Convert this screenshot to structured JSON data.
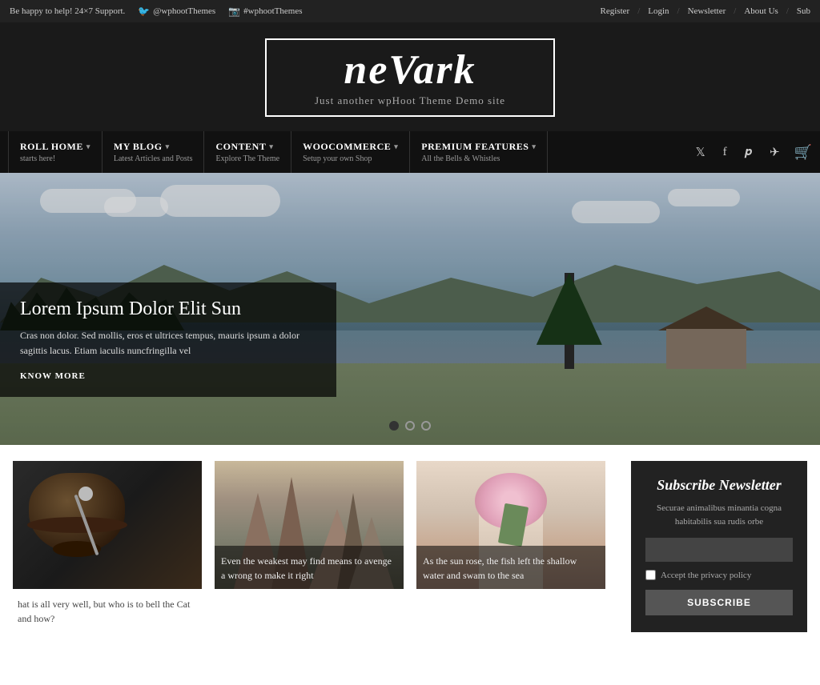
{
  "topbar": {
    "support_text": "Be happy to help! 24×7 Support.",
    "twitter_handle": "@wphootThemes",
    "instagram_handle": "#wphootThemes",
    "register": "Register",
    "login": "Login",
    "newsletter": "Newsletter",
    "about_us": "About Us",
    "subscribe": "Sub"
  },
  "site": {
    "title_ne": "ne",
    "title_vark": "Vark",
    "tagline": "Just another wpHoot Theme Demo site"
  },
  "nav": {
    "items": [
      {
        "id": "roll-home",
        "title": "ROLL HOME",
        "sub": "starts here!",
        "has_dropdown": true
      },
      {
        "id": "my-blog",
        "title": "MY BLOG",
        "sub": "Latest Articles and Posts",
        "has_dropdown": true
      },
      {
        "id": "content",
        "title": "CONTENT",
        "sub": "Explore The Theme",
        "has_dropdown": true
      },
      {
        "id": "woocommerce",
        "title": "WOOCOMMERCE",
        "sub": "Setup your own Shop",
        "has_dropdown": true
      },
      {
        "id": "premium-features",
        "title": "PREMIUM FEATURES",
        "sub": "All the Bells & Whistles",
        "has_dropdown": true
      }
    ]
  },
  "hero": {
    "title": "Lorem Ipsum Dolor Elit Sun",
    "text": "Cras non dolor. Sed mollis, eros et ultrices tempus, mauris ipsum a dolor sagittis lacus. Etiam iaculis nuncfringilla vel",
    "link_label": "KNOW MORE",
    "dots": [
      {
        "active": true
      },
      {
        "active": false
      },
      {
        "active": false
      }
    ]
  },
  "cards": [
    {
      "id": "food",
      "caption": "hat is all very well, but who is to bell the Cat and how?"
    },
    {
      "id": "rock",
      "caption": "Even the weakest may find means to avenge a wrong to make it right"
    },
    {
      "id": "flower",
      "caption": "As the sun rose, the fish left the shallow water and swam to the sea"
    }
  ],
  "newsletter": {
    "title": "Subscribe Newsletter",
    "text": "Securae animalibus minantia cogna habitabilis sua rudis orbe",
    "input_placeholder": "",
    "privacy_label": "Accept the privacy policy",
    "button_label": "SUBSCRIBE"
  }
}
